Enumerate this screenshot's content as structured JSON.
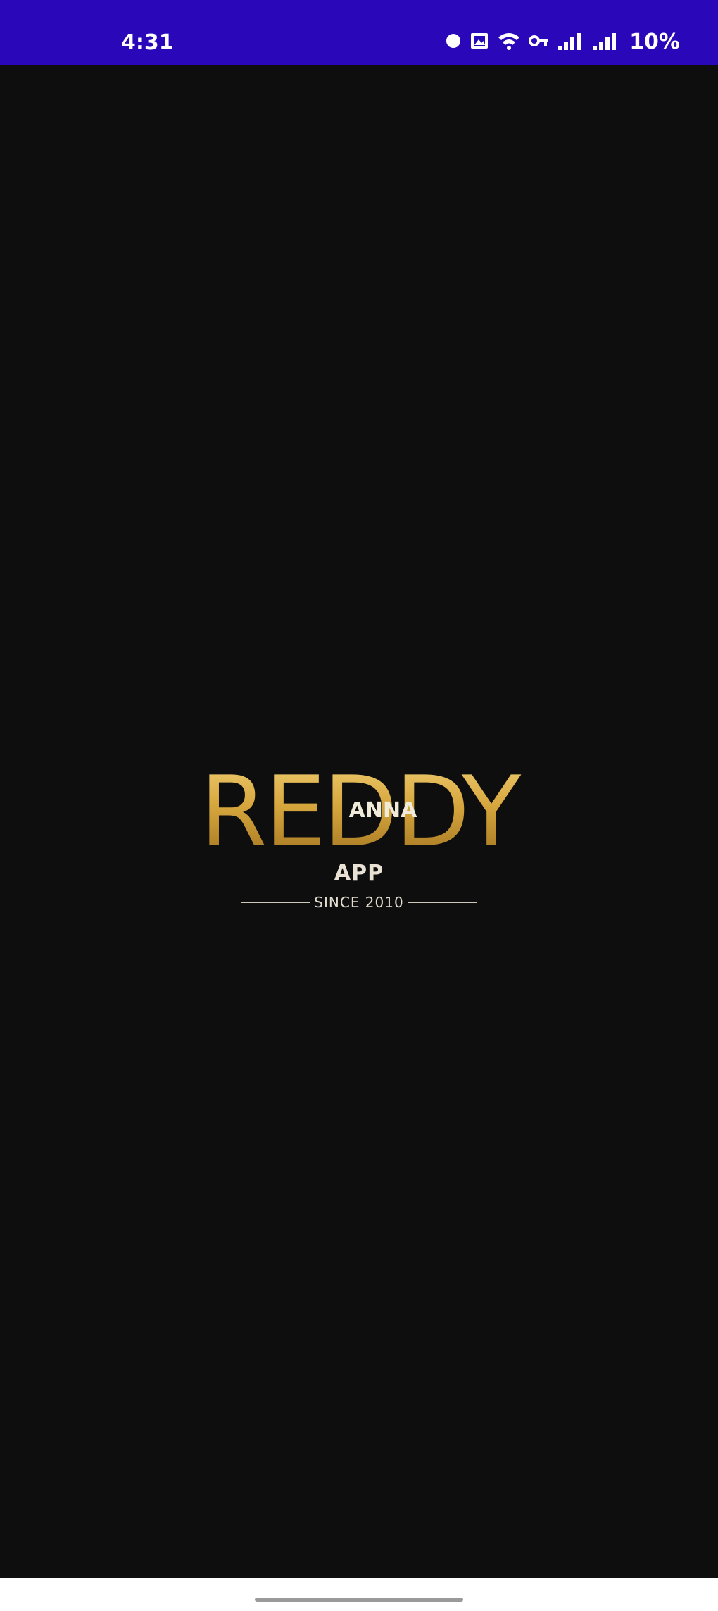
{
  "status_bar": {
    "time": "4:31",
    "battery": "10%",
    "background_color": "#2a07b8",
    "icons": [
      "notification-dot-icon",
      "gallery-icon",
      "wifi-icon",
      "vpn-key-icon",
      "signal-icon",
      "signal-icon-2"
    ]
  },
  "logo": {
    "brand_text": "REDDY",
    "overlay_text": "ANNA",
    "app_label": "APP",
    "since_text": "SINCE 2010",
    "gold_color": "#d4a53c"
  },
  "screen": {
    "background_color": "#0e0e0e"
  }
}
